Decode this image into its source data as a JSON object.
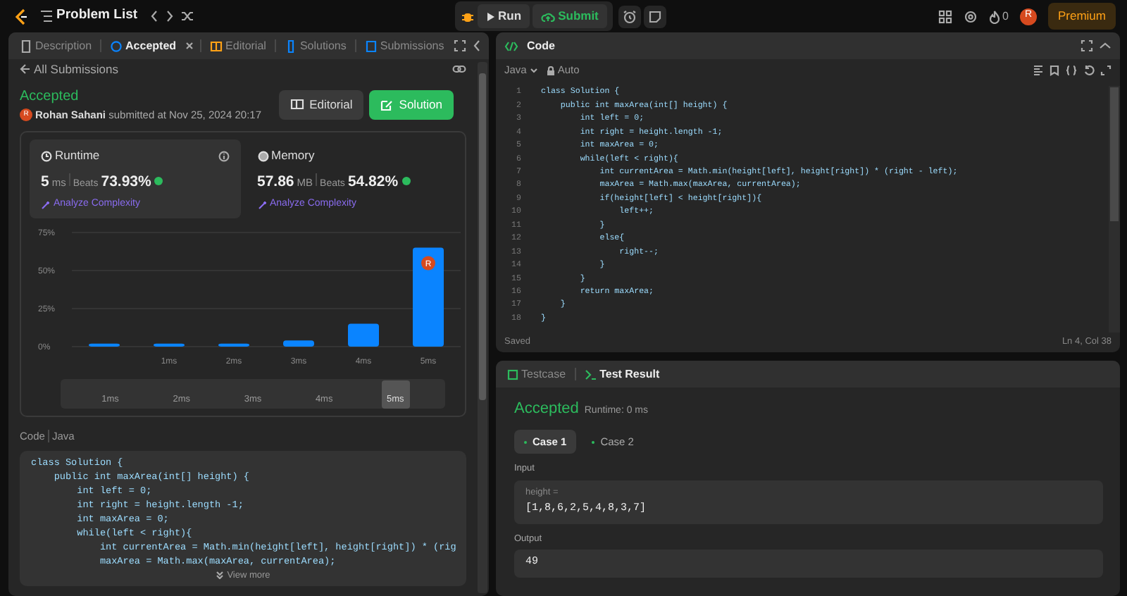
{
  "top_bar": {
    "title": "Problem List",
    "run_label": "Run",
    "submit_label": "Submit",
    "streak": "0",
    "avatar": "R",
    "premium": "Premium"
  },
  "left_panel": {
    "tabs": [
      {
        "label": "Description",
        "selected": false,
        "closable": false
      },
      {
        "label": "Accepted",
        "selected": true,
        "closable": true
      },
      {
        "label": "Editorial",
        "selected": false,
        "closable": false
      },
      {
        "label": "Solutions",
        "selected": false,
        "closable": false
      },
      {
        "label": "Submissions",
        "selected": false,
        "closable": false
      }
    ],
    "back_link": "All Submissions",
    "status": "Accepted",
    "author_avatar": "R",
    "author": "Rohan Sahani",
    "submitted": "submitted at Nov 25, 2024 20:17",
    "buttons": [
      {
        "label": "Editorial",
        "kind": "secondary"
      },
      {
        "label": "Solution",
        "kind": "primary"
      }
    ],
    "stats": [
      {
        "title": "Runtime",
        "value": "5",
        "unit": "ms",
        "beats_label": "Beats",
        "beats": "73.93%",
        "link": "Analyze Complexity",
        "selected": true
      },
      {
        "title": "Memory",
        "value": "57.86",
        "unit": "MB",
        "beats_label": "Beats",
        "beats": "54.82%",
        "link": "Analyze Complexity",
        "selected": false
      }
    ],
    "chart_data": {
      "type": "bar",
      "categories": [
        null,
        "1ms",
        "2ms",
        "3ms",
        "4ms",
        "5ms"
      ],
      "series": [
        {
          "color": "#0a84ff",
          "values": [
            2,
            2,
            2,
            4,
            15,
            65
          ]
        }
      ],
      "ylim": [
        0,
        75
      ],
      "yticks": [
        {
          "value": 0,
          "label": "0%"
        },
        {
          "value": 25,
          "label": "25%"
        },
        {
          "value": 50,
          "label": "50%"
        },
        {
          "value": 75,
          "label": "75%"
        }
      ]
    },
    "chart_avatar": "R",
    "range": [
      {
        "label": "1ms",
        "selected": false
      },
      {
        "label": "2ms",
        "selected": false
      },
      {
        "label": "3ms",
        "selected": false
      },
      {
        "label": "4ms",
        "selected": false
      },
      {
        "label": "5ms",
        "selected": true
      }
    ],
    "code_label": "Code",
    "language": "Java",
    "code": [
      "class Solution {",
      "    public int maxArea(int[] height) {",
      "        int left = 0;",
      "        int right = height.length -1;",
      "        int maxArea = 0;",
      "        while(left < right){",
      "            int currentArea = Math.min(height[left], height[right]) * (rig",
      "            maxArea = Math.max(maxArea, currentArea);"
    ],
    "view_more": "View more"
  },
  "editor": {
    "title": "Code",
    "language": "Java",
    "mode": "Auto",
    "lines": [
      {
        "number": "1",
        "text": "class Solution {"
      },
      {
        "number": "2",
        "text": "    public int maxArea(int[] height) {"
      },
      {
        "number": "3",
        "text": "        int left = 0;"
      },
      {
        "number": "4",
        "text": "        int right = height.length -1;"
      },
      {
        "number": "5",
        "text": "        int maxArea = 0;"
      },
      {
        "number": "6",
        "text": "        while(left < right){"
      },
      {
        "number": "7",
        "text": "            int currentArea = Math.min(height[left], height[right]) * (right - left);"
      },
      {
        "number": "8",
        "text": "            maxArea = Math.max(maxArea, currentArea);"
      },
      {
        "number": "9",
        "text": "            if(height[left] < height[right]){"
      },
      {
        "number": "10",
        "text": "                left++;"
      },
      {
        "number": "11",
        "text": "            }"
      },
      {
        "number": "12",
        "text": "            else{"
      },
      {
        "number": "13",
        "text": "                right--;"
      },
      {
        "number": "14",
        "text": "            }"
      },
      {
        "number": "15",
        "text": "        }"
      },
      {
        "number": "16",
        "text": "        return maxArea;"
      },
      {
        "number": "17",
        "text": "    }"
      },
      {
        "number": "18",
        "text": "}"
      }
    ],
    "status": "Saved",
    "cursor": "Ln 4, Col 38"
  },
  "result": {
    "tabs": [
      {
        "label": "Testcase",
        "selected": false
      },
      {
        "label": "Test Result",
        "selected": true
      }
    ],
    "verdict": "Accepted",
    "runtime": "Runtime: 0 ms",
    "cases": [
      {
        "label": "Case 1",
        "selected": true
      },
      {
        "label": "Case 2",
        "selected": false
      }
    ],
    "input_label": "Input",
    "param": "height =",
    "input": "[1,8,6,2,5,4,8,3,7]",
    "output_label": "Output",
    "output": "49"
  }
}
